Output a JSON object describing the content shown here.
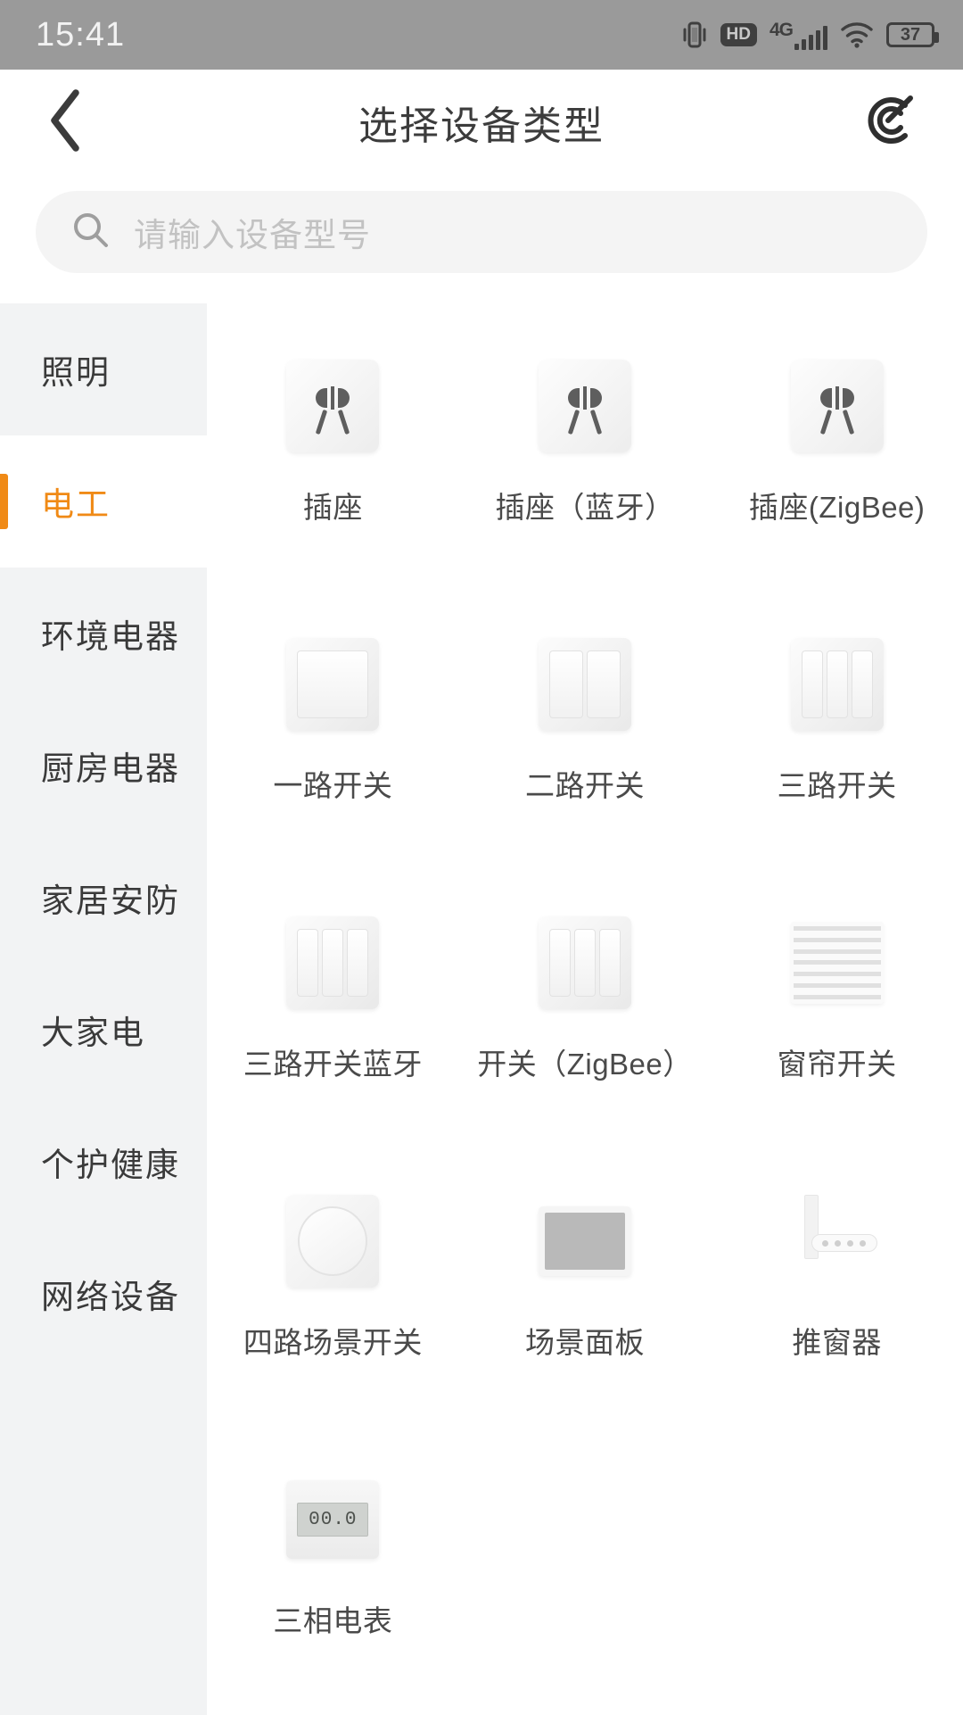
{
  "status_bar": {
    "time": "15:41",
    "battery_level": "37",
    "network_label": "4G",
    "hd_label": "HD",
    "icons": [
      "vibrate-icon",
      "hd-icon",
      "4g-signal-icon",
      "wifi-icon",
      "battery-icon"
    ]
  },
  "header": {
    "title": "选择设备类型",
    "back_icon": "chevron-left-icon",
    "scan_icon": "scan-target-icon"
  },
  "search": {
    "placeholder": "请输入设备型号",
    "value": "",
    "icon": "search-icon"
  },
  "sidebar": {
    "active_index": 1,
    "items": [
      {
        "label": "照明"
      },
      {
        "label": "电工"
      },
      {
        "label": "环境电器"
      },
      {
        "label": "厨房电器"
      },
      {
        "label": "家居安防"
      },
      {
        "label": "大家电"
      },
      {
        "label": "个护健康"
      },
      {
        "label": "网络设备"
      }
    ]
  },
  "colors": {
    "accent": "#f08a16",
    "status_bar_bg": "#9a9a9a",
    "sidebar_bg": "#f2f3f4",
    "label_text": "#4a4a4a",
    "placeholder": "#c2c2c2"
  },
  "grid": {
    "rows": [
      {
        "tiles": [
          {
            "label": "插座",
            "art": "socket-icon"
          },
          {
            "label": "插座（蓝牙）",
            "art": "socket-icon"
          },
          {
            "label": "插座(ZigBee)",
            "art": "socket-icon"
          }
        ]
      },
      {
        "tiles": [
          {
            "label": "一路开关",
            "art": "switch-1gang-icon"
          },
          {
            "label": "二路开关",
            "art": "switch-2gang-icon"
          },
          {
            "label": "三路开关",
            "art": "switch-3gang-icon"
          }
        ]
      },
      {
        "tiles": [
          {
            "label": "三路开关蓝牙",
            "art": "switch-3gang-icon"
          },
          {
            "label": "开关（ZigBee）",
            "art": "switch-3gang-icon"
          },
          {
            "label": "窗帘开关",
            "art": "curtain-icon"
          }
        ]
      },
      {
        "tiles": [
          {
            "label": "四路场景开关",
            "art": "scene-knob-icon"
          },
          {
            "label": "场景面板",
            "art": "scene-panel-icon"
          },
          {
            "label": "推窗器",
            "art": "window-opener-icon"
          }
        ]
      },
      {
        "tiles": [
          {
            "label": "三相电表",
            "art": "meter-icon",
            "display": "00.0"
          }
        ]
      }
    ]
  }
}
